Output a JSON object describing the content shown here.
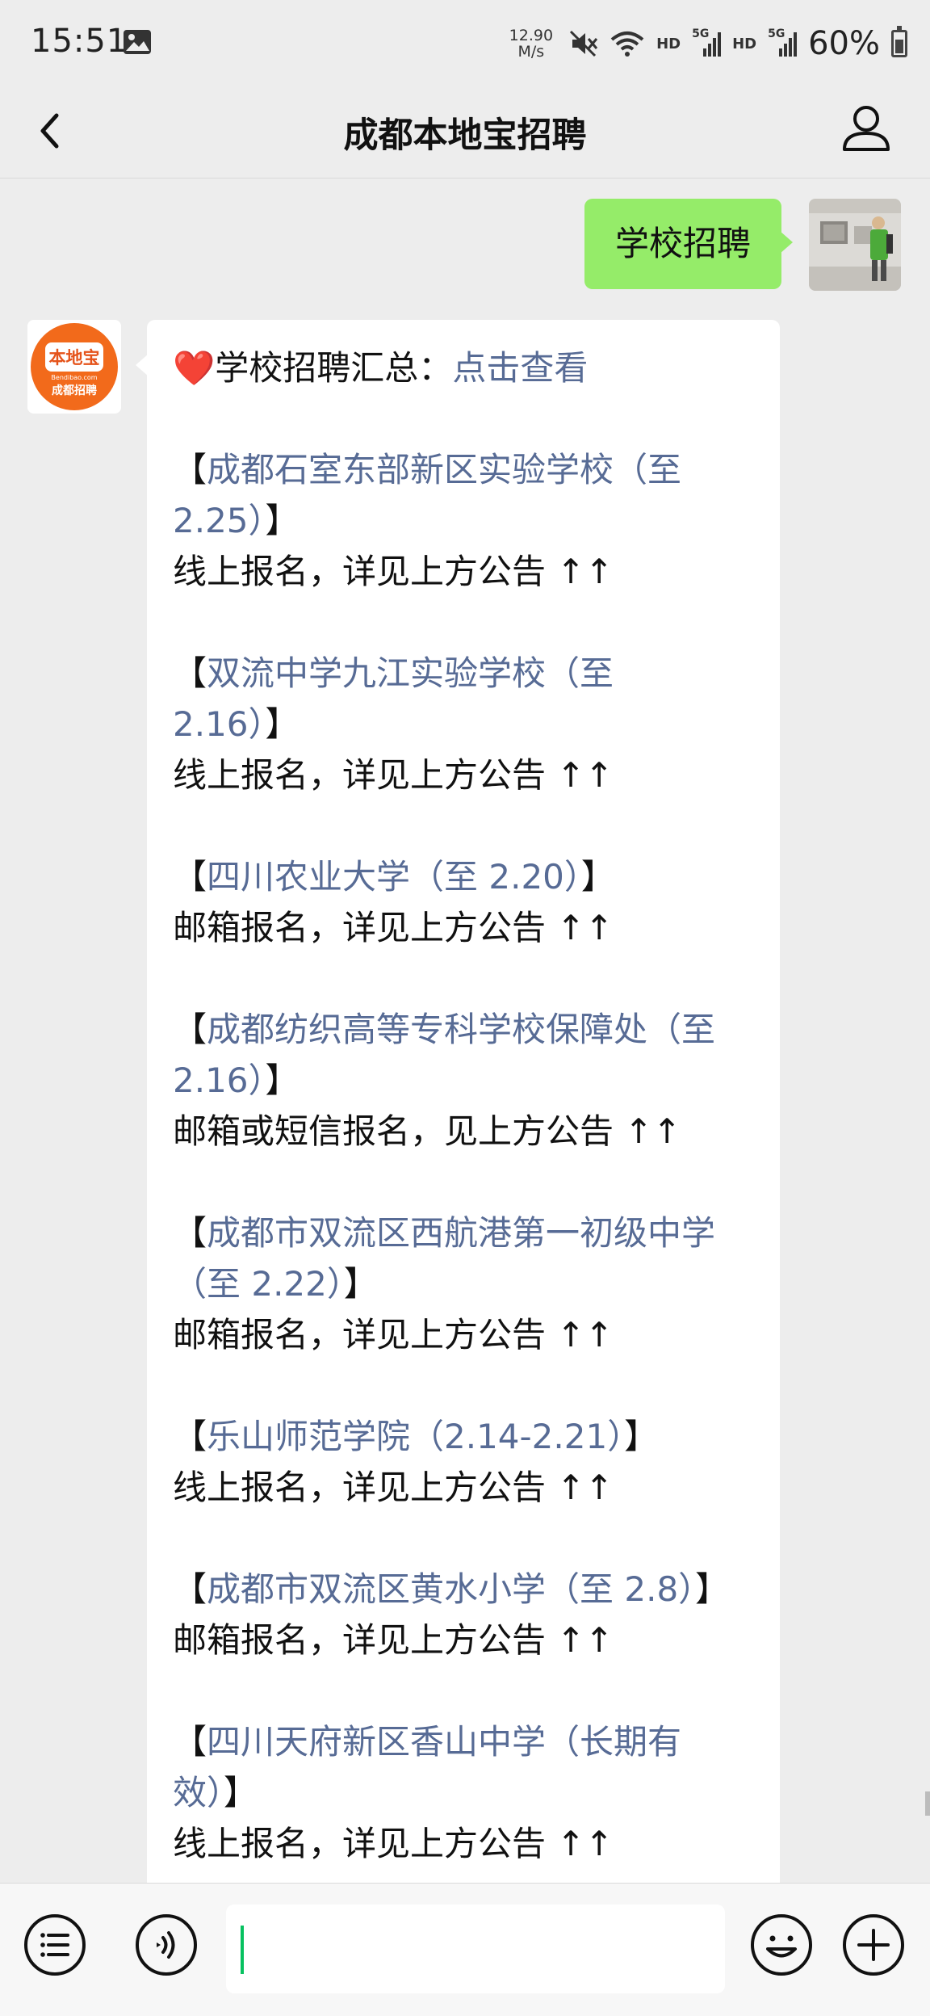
{
  "status_bar": {
    "time": "15:51",
    "net_speed_value": "12.90",
    "net_speed_unit": "M/s",
    "hd1": "HD",
    "net1": "5G",
    "hd2": "HD",
    "net2": "5G",
    "battery_percent": "60%",
    "battery_level": 0.6
  },
  "header": {
    "title": "成都本地宝招聘"
  },
  "messages": {
    "user_text": "学校招聘",
    "bot": {
      "intro_prefix": "学校招聘汇总：",
      "intro_link": "点击查看",
      "entries": [
        {
          "open": "【",
          "link": "成都石室东部新区实验学校（至",
          "link2": "2.25）",
          "close": "】",
          "desc": "线上报名，详见上方公告 ↑↑"
        },
        {
          "open": "【",
          "link": "双流中学九江实验学校（至",
          "link2": "2.16）",
          "close": "】",
          "desc": "线上报名，详见上方公告 ↑↑"
        },
        {
          "open": "【",
          "link": "四川农业大学（至 2.20）",
          "close": "】",
          "desc": "邮箱报名，详见上方公告 ↑↑"
        },
        {
          "open": "【",
          "link": "成都纺织高等专科学校保障处（至",
          "link2": "2.16）",
          "close": "】",
          "desc": "邮箱或短信报名，见上方公告 ↑↑"
        },
        {
          "open": "【",
          "link": "成都市双流区西航港第一初级中学",
          "link2": "（至 2.22）",
          "close": "】",
          "desc": "邮箱报名，详见上方公告 ↑↑"
        },
        {
          "open": "【",
          "link": "乐山师范学院（2.14-2.21）",
          "close": "】",
          "desc": "线上报名，详见上方公告 ↑↑"
        },
        {
          "open": "【",
          "link": "成都市双流区黄水小学（至 2.8）",
          "close": "】",
          "desc": "邮箱报名，详见上方公告 ↑↑"
        },
        {
          "open": "【",
          "link": "四川天府新区香山中学（长期有",
          "link2": "效）",
          "close": "】",
          "desc": "线上报名，详见上方公告 ↑↑"
        }
      ]
    }
  },
  "logo": {
    "top": "本地宝",
    "url": "Bendibao.com",
    "bottom": "成都招聘"
  },
  "colors": {
    "wechat_green": "#95ec69",
    "link": "#576b95",
    "background": "#ededed",
    "logo_orange": "#f26a1b"
  },
  "icons": {
    "back": "chevron-left-icon",
    "profile": "person-icon",
    "menu": "list-icon",
    "voice": "voice-icon",
    "emoji": "smiley-icon",
    "add": "plus-icon"
  }
}
